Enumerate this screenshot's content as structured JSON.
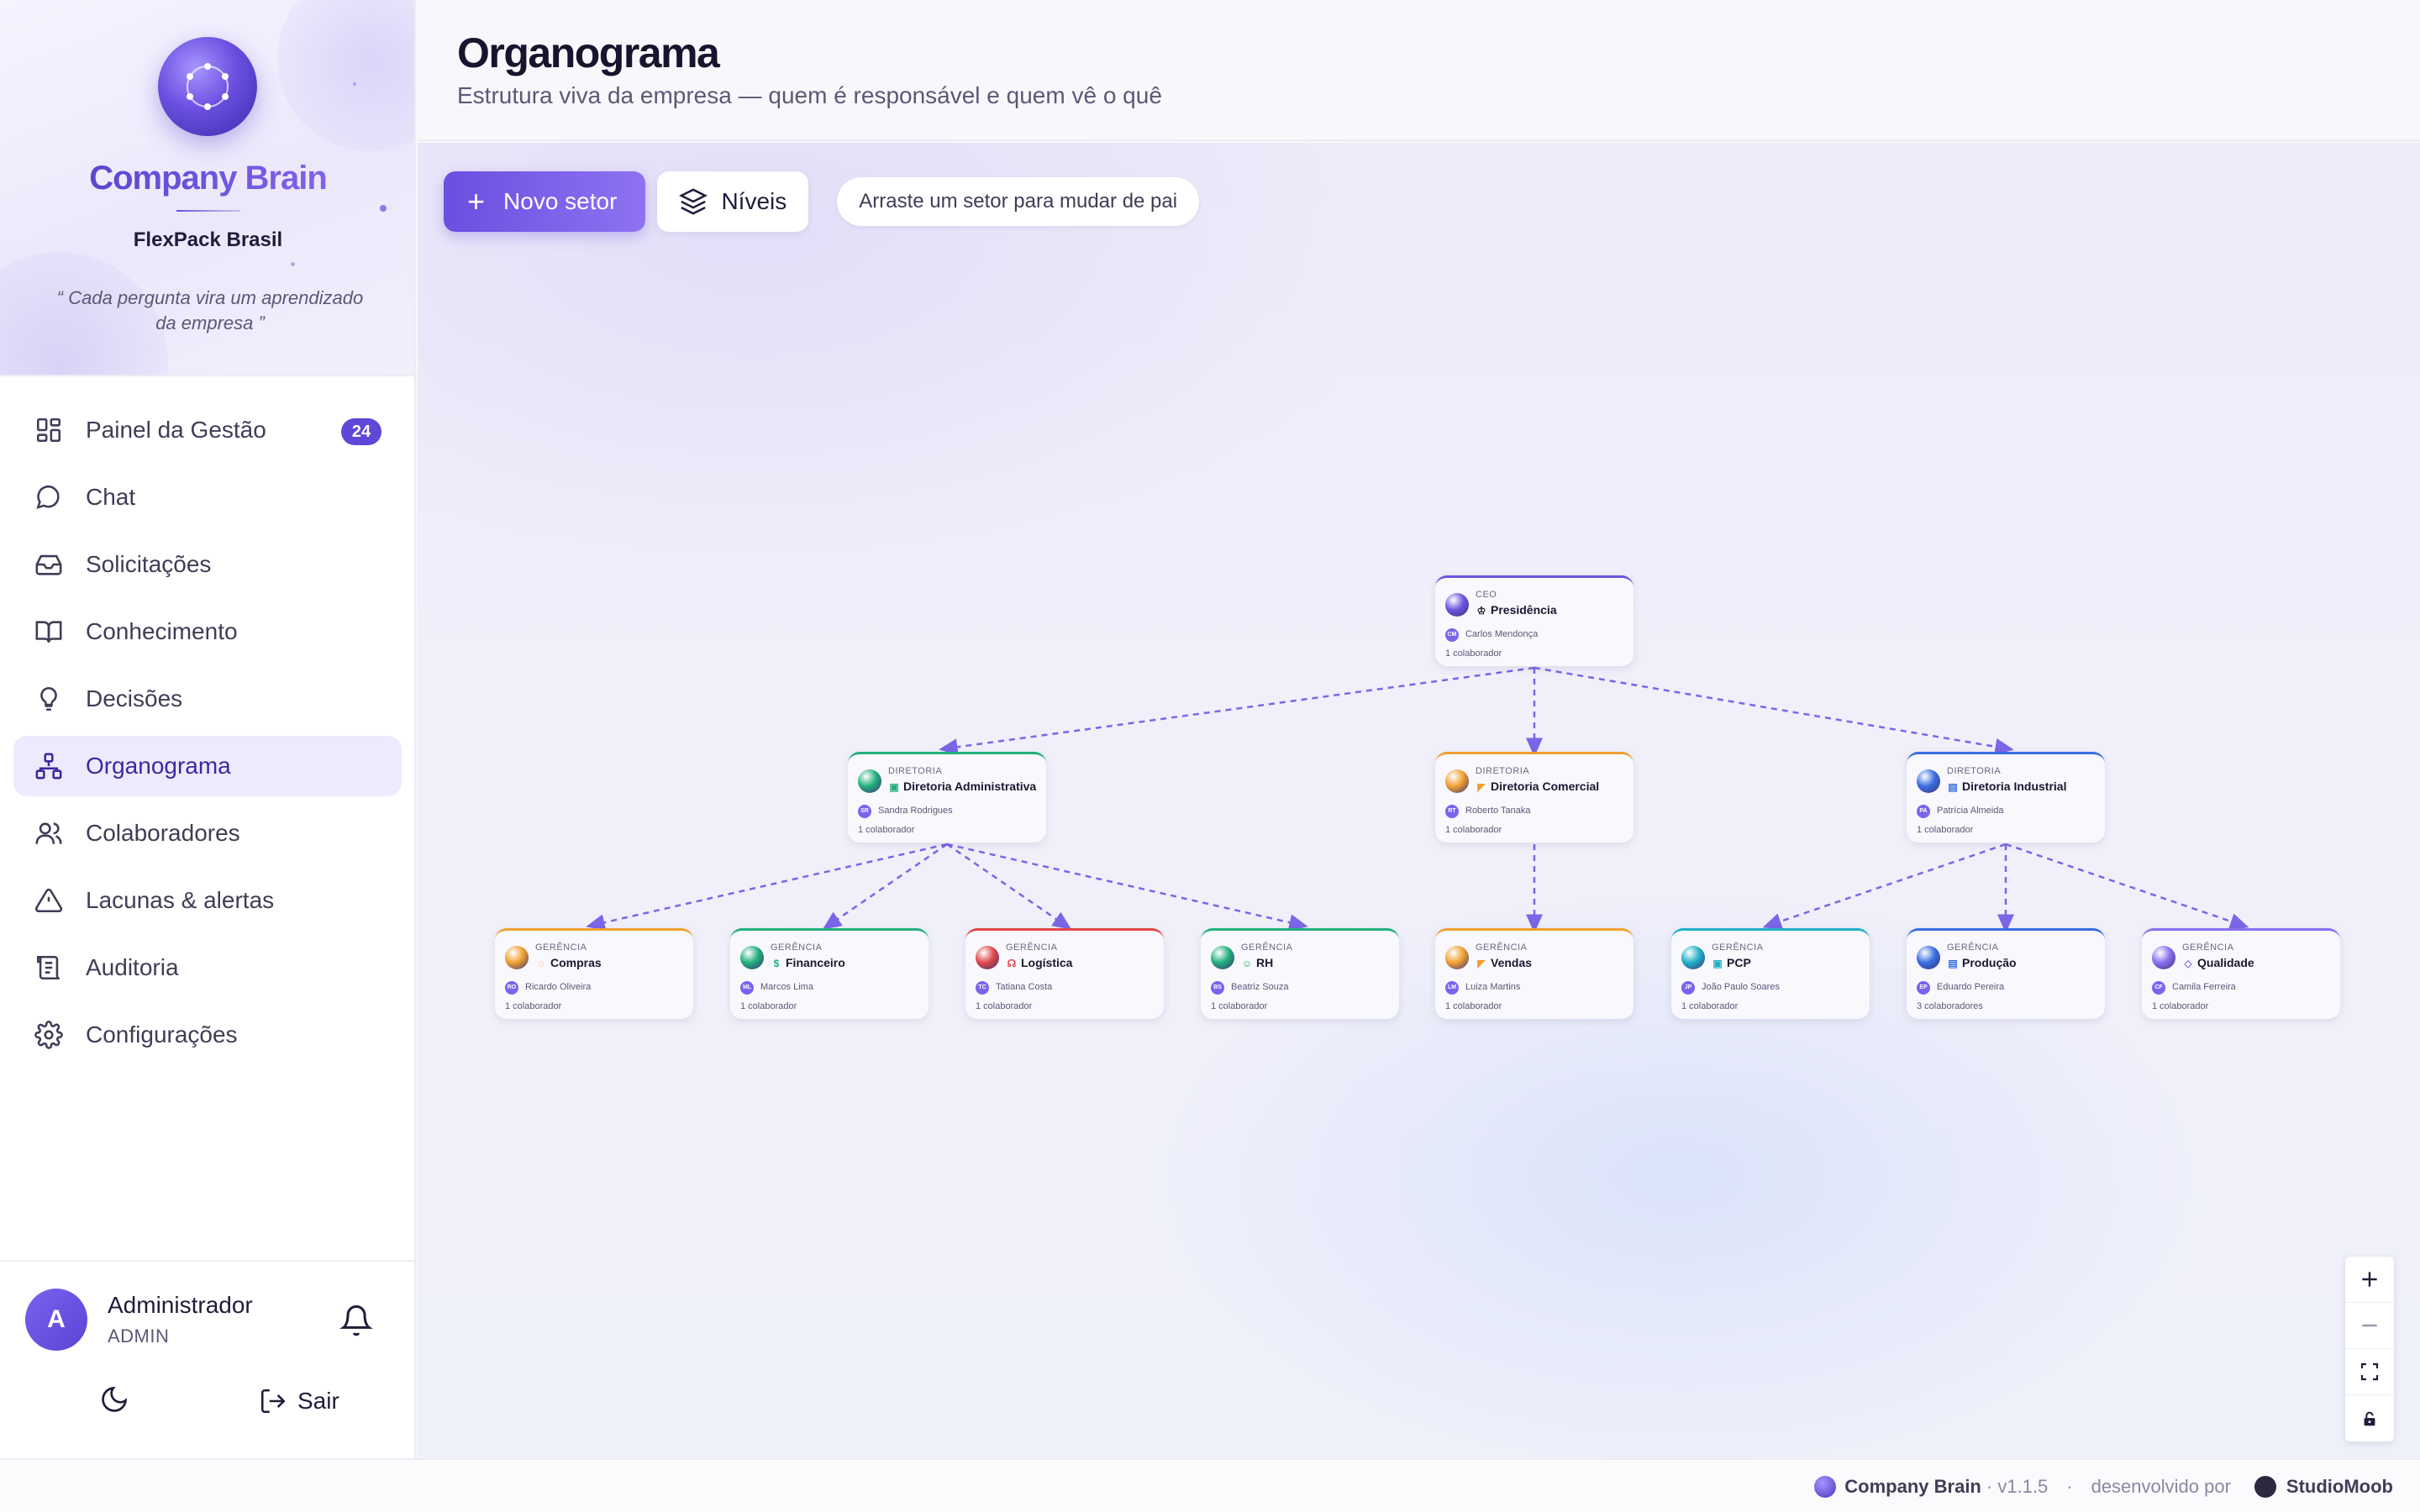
{
  "brand": {
    "title": "Company Brain",
    "company": "FlexPack Brasil",
    "quote": "“ Cada pergunta vira um aprendizado da empresa ”"
  },
  "nav": [
    {
      "label": "Painel da Gestão",
      "icon": "dashboard-icon",
      "badge": "24"
    },
    {
      "label": "Chat",
      "icon": "chat-icon"
    },
    {
      "label": "Solicitações",
      "icon": "inbox-icon"
    },
    {
      "label": "Conhecimento",
      "icon": "book-icon"
    },
    {
      "label": "Decisões",
      "icon": "lightbulb-icon"
    },
    {
      "label": "Organograma",
      "icon": "org-chart-icon",
      "active": true
    },
    {
      "label": "Colaboradores",
      "icon": "users-icon"
    },
    {
      "label": "Lacunas & alertas",
      "icon": "alert-triangle-icon"
    },
    {
      "label": "Auditoria",
      "icon": "audit-list-icon"
    },
    {
      "label": "Configurações",
      "icon": "gear-icon"
    }
  ],
  "user": {
    "initial": "A",
    "name": "Administrador",
    "role": "ADMIN",
    "logout_label": "Sair"
  },
  "header": {
    "title": "Organograma",
    "subtitle": "Estrutura viva da empresa — quem é responsável e quem vê o quê"
  },
  "toolbar": {
    "new_sector_label": "Novo setor",
    "levels_label": "Níveis",
    "hint": "Arraste um setor para mudar de pai"
  },
  "org": {
    "ceo": {
      "level": "CEO",
      "name": "Presidência",
      "icon": "crown-icon",
      "person": "Carlos Mendonça",
      "initials": "CM",
      "count": "1 colaborador",
      "color": "#6b55e0"
    },
    "directors": [
      {
        "level": "DIRETORIA",
        "name": "Diretoria Administrativa",
        "icon": "building-icon",
        "person": "Sandra Rodrigues",
        "initials": "SR",
        "count": "1 colaborador",
        "color": "#22b07d"
      },
      {
        "level": "DIRETORIA",
        "name": "Diretoria Comercial",
        "icon": "megaphone-icon",
        "person": "Roberto Tanaka",
        "initials": "RT",
        "count": "1 colaborador",
        "color": "#f0a030"
      },
      {
        "level": "DIRETORIA",
        "name": "Diretoria Industrial",
        "icon": "factory-icon",
        "person": "Patrícia Almeida",
        "initials": "PA",
        "count": "1 colaborador",
        "color": "#3a6ee0"
      }
    ],
    "managers": [
      {
        "level": "GERÊNCIA",
        "name": "Compras",
        "icon": "cart-icon",
        "person": "Ricardo Oliveira",
        "initials": "RO",
        "count": "1 colaborador",
        "color": "#f0a030"
      },
      {
        "level": "GERÊNCIA",
        "name": "Financeiro",
        "icon": "dollar-icon",
        "person": "Marcos Lima",
        "initials": "ML",
        "count": "1 colaborador",
        "color": "#22b07d"
      },
      {
        "level": "GERÊNCIA",
        "name": "Logística",
        "icon": "headset-icon",
        "person": "Tatiana Costa",
        "initials": "TC",
        "count": "1 colaborador",
        "color": "#e04848"
      },
      {
        "level": "GERÊNCIA",
        "name": "RH",
        "icon": "users-icon",
        "person": "Beatriz Souza",
        "initials": "BS",
        "count": "1 colaborador",
        "color": "#22b07d"
      },
      {
        "level": "GERÊNCIA",
        "name": "Vendas",
        "icon": "megaphone-icon",
        "person": "Luiza Martins",
        "initials": "LM",
        "count": "1 colaborador",
        "color": "#f0a030"
      },
      {
        "level": "GERÊNCIA",
        "name": "PCP",
        "icon": "building-icon",
        "person": "João Paulo Soares",
        "initials": "JP",
        "count": "1 colaborador",
        "color": "#20b0c8"
      },
      {
        "level": "GERÊNCIA",
        "name": "Produção",
        "icon": "factory-icon",
        "person": "Eduardo Pereira",
        "initials": "EP",
        "count": "3 colaboradores",
        "color": "#3a6ee0"
      },
      {
        "level": "GERÊNCIA",
        "name": "Qualidade",
        "icon": "shield-icon",
        "person": "Camila Ferreira",
        "initials": "CF",
        "count": "1 colaborador",
        "color": "#8a6ff0"
      }
    ]
  },
  "footer": {
    "app": "Company Brain",
    "version": "· v1.1.5",
    "sep": "·",
    "dev_by": "desenvolvido por",
    "studio": "StudioMoob"
  }
}
